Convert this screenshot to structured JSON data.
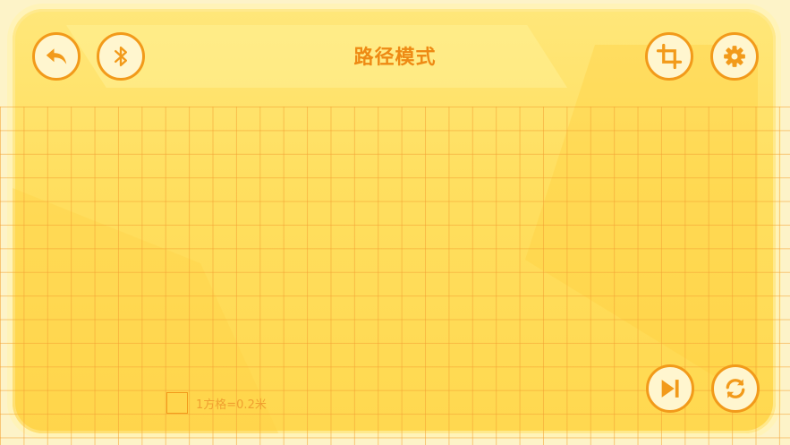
{
  "header": {
    "title": "路径模式"
  },
  "toolbar": {
    "back_icon": "back-arrow-icon",
    "bluetooth_icon": "bluetooth-icon",
    "crop_icon": "crop-icon",
    "settings_icon": "gear-icon",
    "skip_icon": "skip-next-icon",
    "refresh_icon": "refresh-icon"
  },
  "legend": {
    "scale_label": "1方格=0.2米"
  },
  "colors": {
    "accent": "#f29a1a",
    "panel": "#ffdf60",
    "grid": "#f4a032",
    "background": "#fdf3c8"
  }
}
